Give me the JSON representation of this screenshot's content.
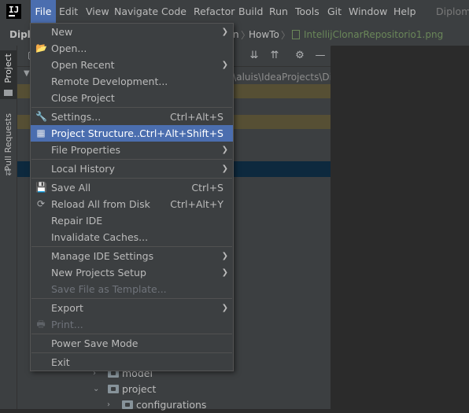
{
  "menubar": {
    "items": [
      "File",
      "Edit",
      "View",
      "Navigate",
      "Code",
      "Refactor",
      "Build",
      "Run",
      "Tools",
      "Git",
      "Window",
      "Help"
    ],
    "title": "Diploma"
  },
  "breadcrumb": {
    "project": "Diplo",
    "parts": [
      "n",
      "HowTo",
      "IntellijClonarRepositorio1.png"
    ]
  },
  "left_strip": {
    "project_tab": "Project",
    "pull_requests_tab": "Pull Requests"
  },
  "panel": {
    "path_fragment": "rs\\aluis\\IdeaProjects\\Dip",
    "tree": [
      {
        "label": "model"
      },
      {
        "label": "project"
      },
      {
        "label": "configurations"
      }
    ]
  },
  "file_menu": {
    "items": [
      {
        "label": "New",
        "shortcut": "",
        "submenu": true
      },
      {
        "label": "Open...",
        "shortcut": "",
        "icon": "folder-open-icon"
      },
      {
        "label": "Open Recent",
        "shortcut": "",
        "submenu": true
      },
      {
        "label": "Remote Development...",
        "shortcut": ""
      },
      {
        "label": "Close Project",
        "shortcut": ""
      },
      {
        "label": "Settings...",
        "shortcut": "Ctrl+Alt+S",
        "icon": "wrench-icon"
      },
      {
        "label": "Project Structure...",
        "shortcut": "Ctrl+Alt+Shift+S",
        "icon": "project-structure-icon",
        "highlighted": true
      },
      {
        "label": "File Properties",
        "shortcut": "",
        "submenu": true
      },
      {
        "label": "Local History",
        "shortcut": "",
        "submenu": true
      },
      {
        "label": "Save All",
        "shortcut": "Ctrl+S",
        "icon": "save-icon"
      },
      {
        "label": "Reload All from Disk",
        "shortcut": "Ctrl+Alt+Y",
        "icon": "reload-icon"
      },
      {
        "label": "Repair IDE",
        "shortcut": ""
      },
      {
        "label": "Invalidate Caches...",
        "shortcut": ""
      },
      {
        "label": "Manage IDE Settings",
        "shortcut": "",
        "submenu": true
      },
      {
        "label": "New Projects Setup",
        "shortcut": "",
        "submenu": true
      },
      {
        "label": "Save File as Template...",
        "shortcut": "",
        "disabled": true
      },
      {
        "label": "Export",
        "shortcut": "",
        "submenu": true
      },
      {
        "label": "Print...",
        "shortcut": "",
        "disabled": true,
        "icon": "print-icon"
      },
      {
        "label": "Power Save Mode",
        "shortcut": ""
      },
      {
        "label": "Exit",
        "shortcut": ""
      }
    ]
  },
  "colors": {
    "highlight": "#4b6eaf",
    "menubar_bg": "#3c3f41",
    "editor_bg": "#2b2b2b",
    "file_link": "#6a8759"
  }
}
